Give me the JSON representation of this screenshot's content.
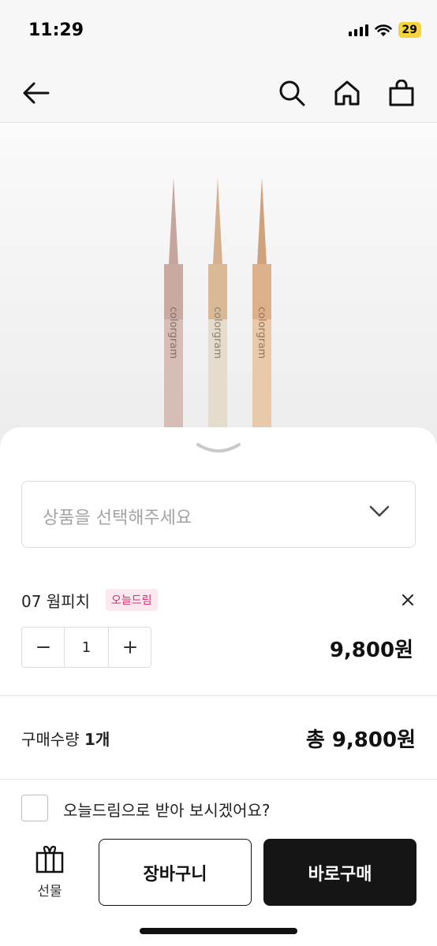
{
  "status_bar": {
    "time": "11:29",
    "battery": "29",
    "icons": [
      "signal-icon",
      "wifi-icon",
      "battery-icon"
    ]
  },
  "nav": {
    "icons": [
      "back-arrow-icon",
      "search-icon",
      "home-icon",
      "shopping-bag-icon"
    ]
  },
  "product_image": {
    "brand_text": "colorgram",
    "pencil_colors": [
      "#c9aaa0",
      "#d9b896",
      "#dcb08a"
    ]
  },
  "sheet": {
    "select": {
      "placeholder": "상품을 선택해주세요"
    },
    "selected_option": {
      "name": "07 웜피치",
      "badge": "오늘드림",
      "quantity": "1",
      "price": "9,800원"
    },
    "summary": {
      "label": "구매수량",
      "count": "1개",
      "total": "총 9,800원"
    },
    "today_dream": {
      "label": "오늘드림으로 받아 보시겠어요?",
      "checked": false
    },
    "actions": {
      "gift_label": "선물",
      "cart_label": "장바구니",
      "buy_label": "바로구매"
    }
  },
  "colors": {
    "accent_badge_text": "#d2306e",
    "accent_badge_bg": "#fbe9ef",
    "primary_button": "#151515"
  }
}
